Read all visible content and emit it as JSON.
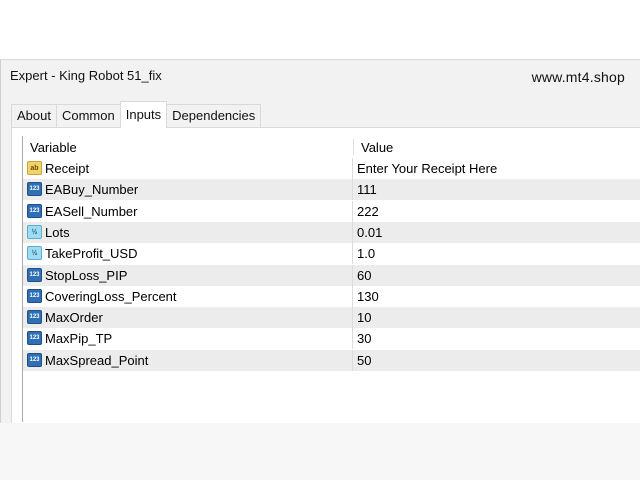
{
  "window": {
    "title": "Expert - King Robot 51_fix",
    "watermark": "www.mt4.shop"
  },
  "tabs": [
    {
      "label": "About",
      "active": false
    },
    {
      "label": "Common",
      "active": false
    },
    {
      "label": "Inputs",
      "active": true
    },
    {
      "label": "Dependencies",
      "active": false
    }
  ],
  "table": {
    "headers": {
      "variable": "Variable",
      "value": "Value"
    },
    "rows": [
      {
        "icon": "string-type-icon",
        "icon_text": "ab",
        "variable": "Receipt",
        "value": "Enter Your Receipt Here"
      },
      {
        "icon": "integer-type-icon",
        "icon_text": "123",
        "variable": "EABuy_Number",
        "value": "111"
      },
      {
        "icon": "integer-type-icon",
        "icon_text": "123",
        "variable": "EASell_Number",
        "value": "222"
      },
      {
        "icon": "double-type-icon",
        "icon_text": "½",
        "variable": "Lots",
        "value": "0.01"
      },
      {
        "icon": "double-type-icon",
        "icon_text": "½",
        "variable": "TakeProfit_USD",
        "value": "1.0"
      },
      {
        "icon": "integer-type-icon",
        "icon_text": "123",
        "variable": "StopLoss_PIP",
        "value": "60"
      },
      {
        "icon": "integer-type-icon",
        "icon_text": "123",
        "variable": "CoveringLoss_Percent",
        "value": "130"
      },
      {
        "icon": "integer-type-icon",
        "icon_text": "123",
        "variable": "MaxOrder",
        "value": "10"
      },
      {
        "icon": "integer-type-icon",
        "icon_text": "123",
        "variable": "MaxPip_TP",
        "value": "30"
      },
      {
        "icon": "integer-type-icon",
        "icon_text": "123",
        "variable": "MaxSpread_Point",
        "value": "50"
      }
    ]
  }
}
